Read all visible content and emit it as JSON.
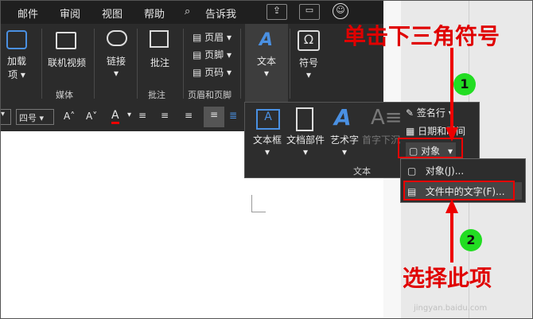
{
  "tabs": [
    "邮件",
    "审阅",
    "视图",
    "帮助",
    "告诉我"
  ],
  "ribbon": {
    "addins": "加载项",
    "online_video": "联机视频",
    "link": "链接",
    "comment": "批注",
    "header": "页眉",
    "footer": "页脚",
    "page_number": "页码",
    "text": "文本",
    "symbol": "符号",
    "groups": {
      "media": "媒体",
      "comments": "批注",
      "header_footer": "页眉和页脚"
    }
  },
  "format": {
    "font_size": "四号"
  },
  "text_panel": {
    "textbox": "文本框",
    "parts": "文档部件",
    "wordart": "艺术字",
    "dropcap": "首字下沉",
    "signature": "签名行",
    "datetime": "日期和时间",
    "object": "对象",
    "group_label": "文本"
  },
  "object_menu": {
    "object_item": "对象(J)...",
    "text_from_file": "文件中的文字(F)..."
  },
  "annotations": {
    "top": "单击下三角符号",
    "bottom": "选择此项",
    "step1": "1",
    "step2": "2"
  },
  "watermark": "jingyan.baidu.com",
  "colors": {
    "red": "#e00000",
    "green": "#22dd22",
    "accent_blue": "#4a90e2"
  }
}
